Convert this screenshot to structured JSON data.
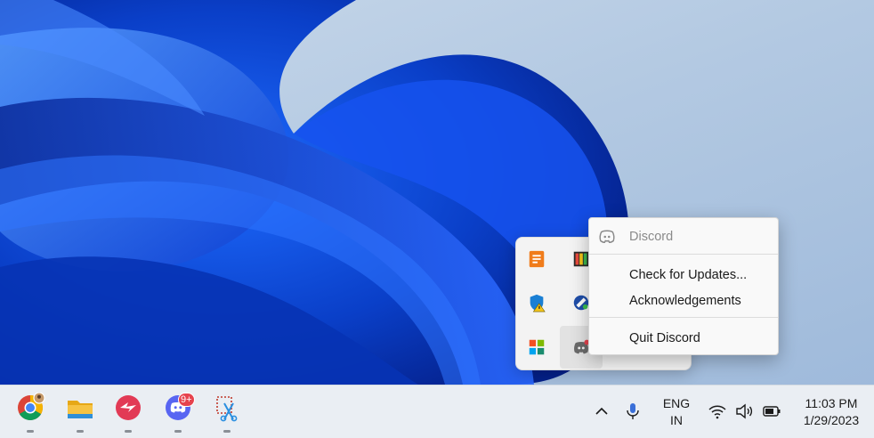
{
  "context_menu": {
    "header": "Discord",
    "items": [
      {
        "label": "Check for Updates..."
      },
      {
        "label": "Acknowledgements"
      },
      {
        "label": "Quit Discord"
      }
    ]
  },
  "tray_overflow": {
    "icons": [
      "stickies-icon",
      "color-palette-icon",
      "windows-security-warning-icon",
      "network-tool-icon",
      "microsoft-store-icon",
      "discord-icon"
    ]
  },
  "taskbar": {
    "apps": [
      {
        "name": "chrome-icon",
        "running": true
      },
      {
        "name": "file-explorer-icon",
        "running": true
      },
      {
        "name": "app-icon",
        "running": true
      },
      {
        "name": "discord-icon",
        "running": true,
        "badge": "9+"
      },
      {
        "name": "snipping-tool-icon",
        "running": true
      }
    ],
    "tray": {
      "language": {
        "line1": "ENG",
        "line2": "IN"
      },
      "time": "11:03 PM",
      "date": "1/29/2023"
    }
  },
  "colors": {
    "discord": "#5865f2",
    "chrome_red": "#db4437",
    "chrome_yellow": "#f4b400",
    "chrome_green": "#0f9d58",
    "folder": "#f6c343",
    "badge": "#e6434e",
    "wallpaper_blue": "#1a4fd8"
  }
}
